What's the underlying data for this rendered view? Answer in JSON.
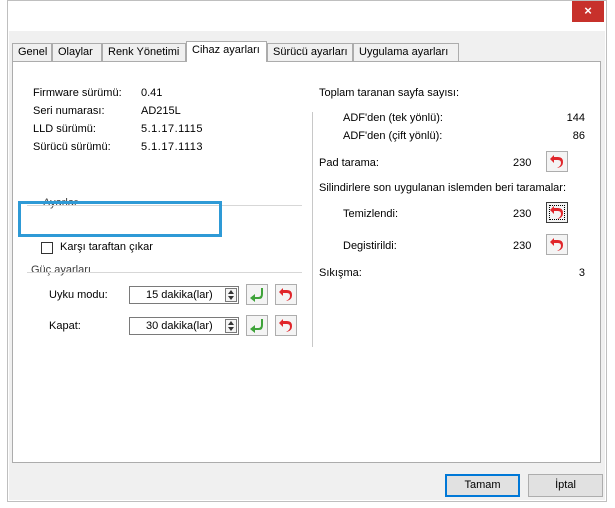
{
  "window": {
    "title": "",
    "close_label": "×"
  },
  "tabs": [
    {
      "label": "Genel"
    },
    {
      "label": "Olaylar"
    },
    {
      "label": "Renk Yönetimi"
    },
    {
      "label": "Cihaz ayarları"
    },
    {
      "label": "Sürücü ayarları"
    },
    {
      "label": "Uygulama ayarları"
    }
  ],
  "device_info": {
    "firmware_label": "Firmware sürümü:",
    "firmware_value": "0.41",
    "serial_label": "Seri numarası:",
    "serial_value": "AD215L",
    "lld_label": "LLD sürümü:",
    "lld_value": "5.1.17.1115",
    "driver_label": "Sürücü sürümü:",
    "driver_value": "5.1.17.1113"
  },
  "settings": {
    "group_label": "Ayarlar",
    "checkbox_label": "Karşı taraftan çıkar",
    "checkbox_checked": false
  },
  "power": {
    "group_label": "Güç ayarları",
    "sleep_label": "Uyku modu:",
    "sleep_value": "15 dakika(lar)",
    "off_label": "Kapat:",
    "off_value": "30 dakika(lar)"
  },
  "stats": {
    "total_label": "Toplam taranan sayfa sayısı:",
    "adf_simplex_label": "ADF'den (tek yönlü):",
    "adf_simplex_value": "144",
    "adf_duplex_label": "ADF'den (çift yönlü):",
    "adf_duplex_value": "86",
    "pad_label": "Pad tarama:",
    "pad_value": "230",
    "roller_label": "Silindirlere son uygulanan islemden beri taramalar:",
    "cleaned_label": "Temizlendi:",
    "cleaned_value": "230",
    "replaced_label": "Degistirildi:",
    "replaced_value": "230",
    "jam_label": "Sıkışma:",
    "jam_value": "3"
  },
  "footer": {
    "ok_label": "Tamam",
    "cancel_label": "İptal"
  },
  "colors": {
    "highlight": "#2e9ad6",
    "close": "#c7312b",
    "reset_icon": "#e0262b",
    "apply_icon": "#3fa33a"
  }
}
